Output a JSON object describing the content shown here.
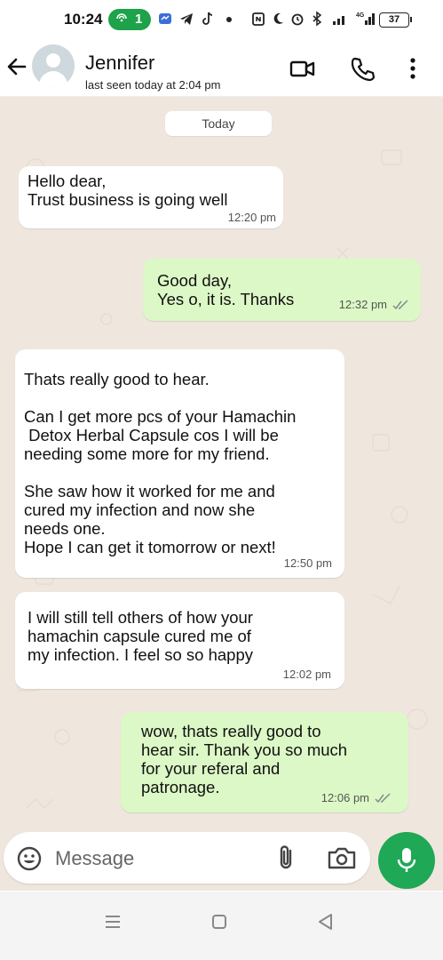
{
  "status_bar": {
    "time": "10:24",
    "hotspot_count": "1",
    "battery": "37",
    "icons_left": [
      "hotspot-icon",
      "messenger-icon",
      "telegram-icon",
      "tiktok-icon",
      "dot-icon"
    ],
    "icons_right": [
      "nfc-icon",
      "moon-icon",
      "alarm-icon",
      "bluetooth-icon",
      "signal-icon",
      "4g-signal-icon",
      "battery-icon"
    ],
    "accent": "#1ea24a"
  },
  "header": {
    "contact_name": "Jennifer",
    "last_seen": "last seen today at 2:04 pm",
    "icons": [
      "back-arrow-icon",
      "video-call-icon",
      "voice-call-icon",
      "more-vertical-icon"
    ]
  },
  "chat": {
    "date_chip": "Today",
    "background": "#efe7de",
    "outgoing_color": "#dcf8c6",
    "incoming_color": "#ffffff",
    "messages": [
      {
        "direction": "incoming",
        "text": "Hello dear,\nTrust business is going well",
        "time": "12:20 pm"
      },
      {
        "direction": "outgoing",
        "text": "Good day,\nYes o, it is. Thanks",
        "time": "12:32 pm",
        "status": "read-ticks"
      },
      {
        "direction": "incoming",
        "text": "Thats really good to hear.\n\nCan I get more pcs of your Hamachin\n Detox Herbal Capsule cos I will be\nneeding some more for my friend.\n\nShe saw how it worked for me and\ncured my infection and now she\nneeds one.\nHope I can get it tomorrow or next!",
        "time": "12:50 pm"
      },
      {
        "direction": "incoming",
        "text": "I will still tell others of how your\nhamachin capsule cured me of\nmy infection. I feel so so happy",
        "time": "12:02 pm"
      },
      {
        "direction": "outgoing",
        "text": "wow, thats really good to\nhear sir. Thank you so much\nfor your referal and\npatronage.",
        "time": "12:06 pm",
        "status": "read-ticks"
      }
    ]
  },
  "composer": {
    "placeholder": "Message",
    "icons": [
      "emoji-icon",
      "attach-icon",
      "camera-icon",
      "mic-icon"
    ],
    "mic_color": "#1fa855"
  },
  "nav_bar": {
    "icons": [
      "menu-icon",
      "home-icon",
      "back-icon"
    ]
  }
}
